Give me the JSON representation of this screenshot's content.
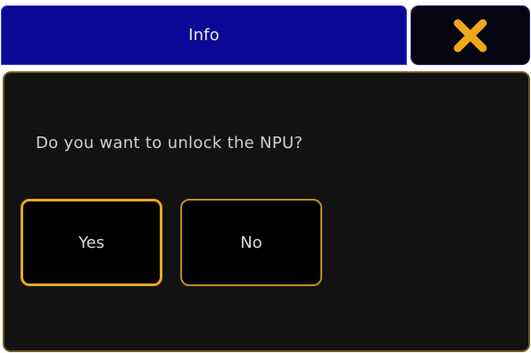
{
  "dialog": {
    "title": "Info",
    "message": "Do you want to unlock the NPU?",
    "close_icon": "close-icon",
    "buttons": {
      "yes_label": "Yes",
      "no_label": "No"
    }
  },
  "colors": {
    "title_bar": "#0a0a96",
    "accent": "#f0a81a",
    "background": "#121212",
    "button_border": "#e8a81c"
  }
}
